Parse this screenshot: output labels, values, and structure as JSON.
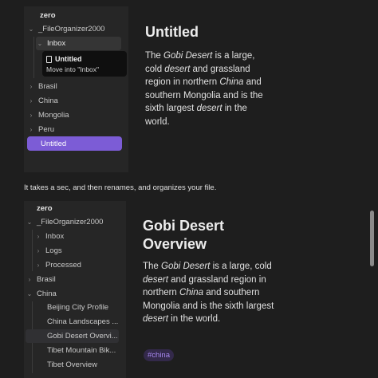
{
  "top_example": {
    "vault": "zero",
    "tree": [
      {
        "label": "_FileOrganizer2000",
        "chevron": "down"
      },
      {
        "label": "Inbox",
        "chevron": "down"
      },
      {
        "label": "Brasil",
        "chevron": "right"
      },
      {
        "label": "China",
        "chevron": "right"
      },
      {
        "label": "Mongolia",
        "chevron": "right"
      },
      {
        "label": "Peru",
        "chevron": "right"
      },
      {
        "label": "Untitled",
        "chevron": ""
      }
    ],
    "tooltip": {
      "title": "Untitled",
      "subtitle": "Move into \"Inbox\""
    },
    "note_title": "Untitled",
    "note_body": {
      "p1": "The ",
      "gobi": "Gobi Desert",
      "p2": " is a large, cold ",
      "desert1": "desert",
      "p3": " and grassland region in northern ",
      "china": "China",
      "p4": " and southern Mongolia and is the sixth largest ",
      "desert2": "desert",
      "p5": " in the world."
    }
  },
  "caption": "It takes a sec, and then renames, and organizes your file.",
  "bottom_example": {
    "vault": "zero",
    "tree": [
      {
        "label": "_FileOrganizer2000",
        "chevron": "down"
      },
      {
        "label": "Inbox",
        "chevron": "right"
      },
      {
        "label": "Logs",
        "chevron": "right"
      },
      {
        "label": "Processed",
        "chevron": "right"
      },
      {
        "label": "Brasil",
        "chevron": "right"
      },
      {
        "label": "China",
        "chevron": "down"
      },
      {
        "label": "Beijing City Profile",
        "chevron": ""
      },
      {
        "label": "China Landscapes ...",
        "chevron": ""
      },
      {
        "label": "Gobi Desert Overvi...",
        "chevron": ""
      },
      {
        "label": "Tibet Mountain Bik...",
        "chevron": ""
      },
      {
        "label": "Tibet Overview",
        "chevron": ""
      }
    ],
    "note_title_line1": "Gobi Desert",
    "note_title_line2": "Overview",
    "note_body": {
      "p1": "The ",
      "gobi": "Gobi Desert",
      "p2": " is a large, cold ",
      "desert1": "desert",
      "p3": " and grassland region in northern ",
      "china": "China",
      "p4": " and southern Mongolia and is the sixth largest ",
      "desert2": "desert",
      "p5": " in the world."
    },
    "tag": "#china"
  }
}
